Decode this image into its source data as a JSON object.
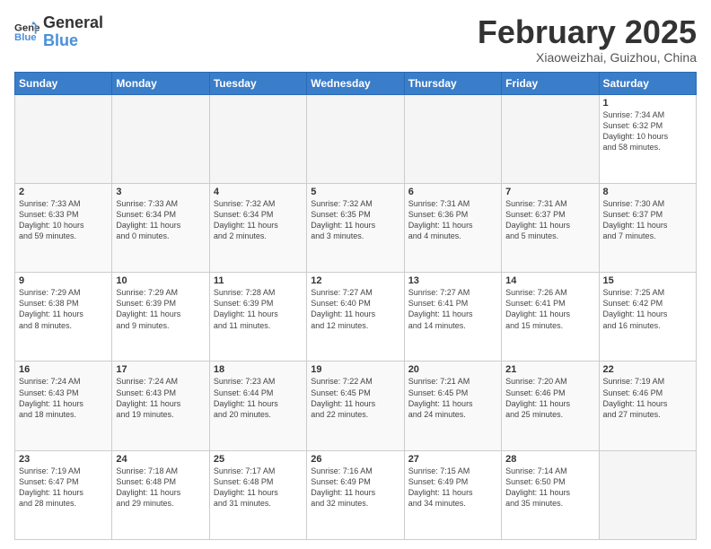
{
  "logo": {
    "line1": "General",
    "line2": "Blue"
  },
  "title": "February 2025",
  "subtitle": "Xiaoweizhai, Guizhou, China",
  "days_of_week": [
    "Sunday",
    "Monday",
    "Tuesday",
    "Wednesday",
    "Thursday",
    "Friday",
    "Saturday"
  ],
  "weeks": [
    [
      {
        "day": "",
        "info": ""
      },
      {
        "day": "",
        "info": ""
      },
      {
        "day": "",
        "info": ""
      },
      {
        "day": "",
        "info": ""
      },
      {
        "day": "",
        "info": ""
      },
      {
        "day": "",
        "info": ""
      },
      {
        "day": "1",
        "info": "Sunrise: 7:34 AM\nSunset: 6:32 PM\nDaylight: 10 hours\nand 58 minutes."
      }
    ],
    [
      {
        "day": "2",
        "info": "Sunrise: 7:33 AM\nSunset: 6:33 PM\nDaylight: 10 hours\nand 59 minutes."
      },
      {
        "day": "3",
        "info": "Sunrise: 7:33 AM\nSunset: 6:34 PM\nDaylight: 11 hours\nand 0 minutes."
      },
      {
        "day": "4",
        "info": "Sunrise: 7:32 AM\nSunset: 6:34 PM\nDaylight: 11 hours\nand 2 minutes."
      },
      {
        "day": "5",
        "info": "Sunrise: 7:32 AM\nSunset: 6:35 PM\nDaylight: 11 hours\nand 3 minutes."
      },
      {
        "day": "6",
        "info": "Sunrise: 7:31 AM\nSunset: 6:36 PM\nDaylight: 11 hours\nand 4 minutes."
      },
      {
        "day": "7",
        "info": "Sunrise: 7:31 AM\nSunset: 6:37 PM\nDaylight: 11 hours\nand 5 minutes."
      },
      {
        "day": "8",
        "info": "Sunrise: 7:30 AM\nSunset: 6:37 PM\nDaylight: 11 hours\nand 7 minutes."
      }
    ],
    [
      {
        "day": "9",
        "info": "Sunrise: 7:29 AM\nSunset: 6:38 PM\nDaylight: 11 hours\nand 8 minutes."
      },
      {
        "day": "10",
        "info": "Sunrise: 7:29 AM\nSunset: 6:39 PM\nDaylight: 11 hours\nand 9 minutes."
      },
      {
        "day": "11",
        "info": "Sunrise: 7:28 AM\nSunset: 6:39 PM\nDaylight: 11 hours\nand 11 minutes."
      },
      {
        "day": "12",
        "info": "Sunrise: 7:27 AM\nSunset: 6:40 PM\nDaylight: 11 hours\nand 12 minutes."
      },
      {
        "day": "13",
        "info": "Sunrise: 7:27 AM\nSunset: 6:41 PM\nDaylight: 11 hours\nand 14 minutes."
      },
      {
        "day": "14",
        "info": "Sunrise: 7:26 AM\nSunset: 6:41 PM\nDaylight: 11 hours\nand 15 minutes."
      },
      {
        "day": "15",
        "info": "Sunrise: 7:25 AM\nSunset: 6:42 PM\nDaylight: 11 hours\nand 16 minutes."
      }
    ],
    [
      {
        "day": "16",
        "info": "Sunrise: 7:24 AM\nSunset: 6:43 PM\nDaylight: 11 hours\nand 18 minutes."
      },
      {
        "day": "17",
        "info": "Sunrise: 7:24 AM\nSunset: 6:43 PM\nDaylight: 11 hours\nand 19 minutes."
      },
      {
        "day": "18",
        "info": "Sunrise: 7:23 AM\nSunset: 6:44 PM\nDaylight: 11 hours\nand 20 minutes."
      },
      {
        "day": "19",
        "info": "Sunrise: 7:22 AM\nSunset: 6:45 PM\nDaylight: 11 hours\nand 22 minutes."
      },
      {
        "day": "20",
        "info": "Sunrise: 7:21 AM\nSunset: 6:45 PM\nDaylight: 11 hours\nand 24 minutes."
      },
      {
        "day": "21",
        "info": "Sunrise: 7:20 AM\nSunset: 6:46 PM\nDaylight: 11 hours\nand 25 minutes."
      },
      {
        "day": "22",
        "info": "Sunrise: 7:19 AM\nSunset: 6:46 PM\nDaylight: 11 hours\nand 27 minutes."
      }
    ],
    [
      {
        "day": "23",
        "info": "Sunrise: 7:19 AM\nSunset: 6:47 PM\nDaylight: 11 hours\nand 28 minutes."
      },
      {
        "day": "24",
        "info": "Sunrise: 7:18 AM\nSunset: 6:48 PM\nDaylight: 11 hours\nand 29 minutes."
      },
      {
        "day": "25",
        "info": "Sunrise: 7:17 AM\nSunset: 6:48 PM\nDaylight: 11 hours\nand 31 minutes."
      },
      {
        "day": "26",
        "info": "Sunrise: 7:16 AM\nSunset: 6:49 PM\nDaylight: 11 hours\nand 32 minutes."
      },
      {
        "day": "27",
        "info": "Sunrise: 7:15 AM\nSunset: 6:49 PM\nDaylight: 11 hours\nand 34 minutes."
      },
      {
        "day": "28",
        "info": "Sunrise: 7:14 AM\nSunset: 6:50 PM\nDaylight: 11 hours\nand 35 minutes."
      },
      {
        "day": "",
        "info": ""
      }
    ]
  ]
}
